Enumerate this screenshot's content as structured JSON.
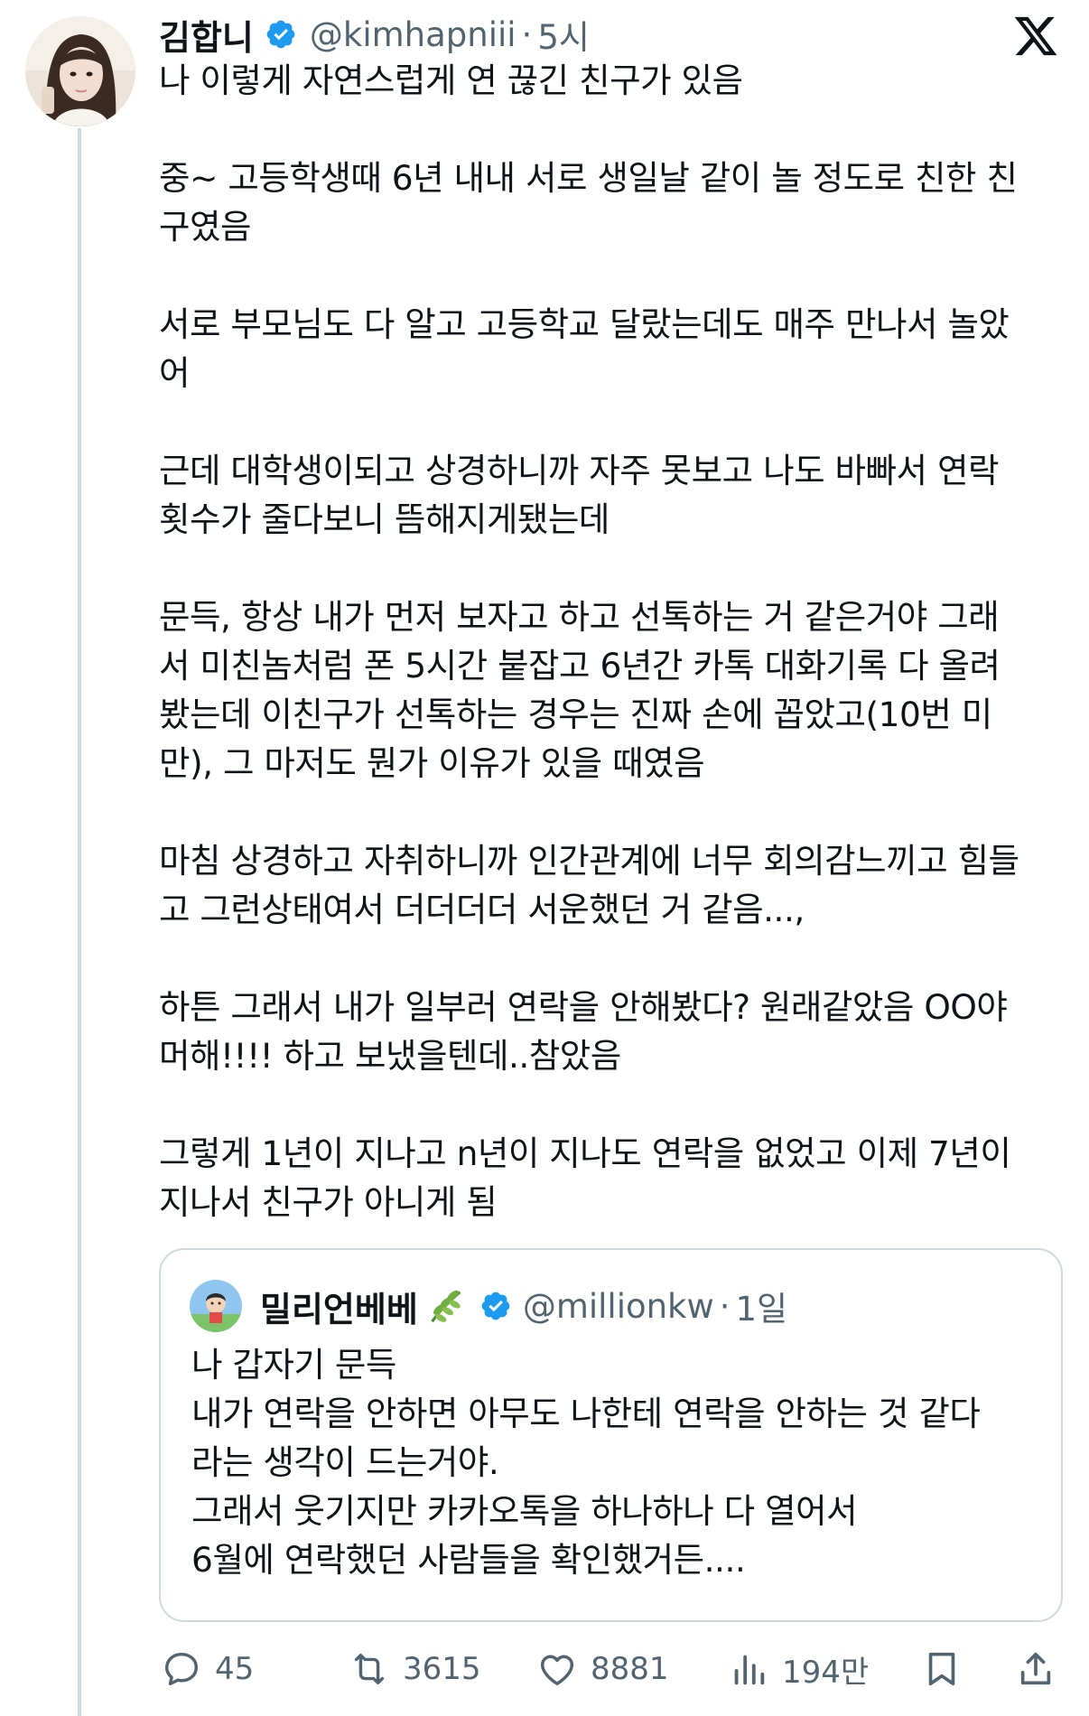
{
  "author": {
    "display_name": "김합니",
    "handle": "@kimhapniii",
    "time": "5시"
  },
  "tweet": {
    "paragraphs": [
      "나 이렇게 자연스럽게 연 끊긴 친구가 있음",
      "중~ 고등학생때 6년 내내 서로 생일날 같이 놀 정도로 친한 친\n구였음",
      "서로 부모님도 다 알고 고등학교 달랐는데도 매주 만나서 놀았\n어",
      "근데 대학생이되고 상경하니까 자주 못보고 나도 바빠서 연락\n횟수가 줄다보니 뜸해지게됐는데",
      "문득, 항상 내가 먼저 보자고 하고 선톡하는 거 같은거야 그래\n서 미친놈처럼 폰 5시간 붙잡고 6년간 카톡 대화기록 다 올려\n봤는데 이친구가 선톡하는 경우는 진짜 손에 꼽았고(10번 미\n만), 그 마저도 뭔가 이유가 있을 때였음",
      "마침 상경하고 자취하니까 인간관계에 너무 회의감느끼고 힘들\n고 그런상태여서 더더더더 서운했던 거 같음...,",
      "하튼 그래서 내가 일부러 연락을 안해봤다? 원래같았음 OO야\n머해!!!! 하고 보냈을텐데..참았음",
      "그렇게 1년이 지나고 n년이 지나도 연락을 없었고 이제 7년이\n지나서 친구가 아니게 됨"
    ]
  },
  "quote": {
    "display_name": "밀리언베베",
    "handle": "@millionkw",
    "time": "1일",
    "text": "나 갑자기 문득\n내가 연락을 안하면 아무도 나한테 연락을 안하는 것 같다\n라는 생각이 드는거야.\n그래서 웃기지만 카카오톡을 하나하나 다 열어서\n6월에 연락했던 사람들을 확인했거든...."
  },
  "actions": {
    "replies": "45",
    "reposts": "3615",
    "likes": "8881",
    "views": "194만"
  },
  "icons": [
    "x-logo-icon",
    "verified-badge-icon",
    "leaf-icon",
    "reply-icon",
    "repost-icon",
    "like-icon",
    "views-icon",
    "bookmark-icon",
    "share-icon"
  ],
  "colors": {
    "text": "#0f1419",
    "secondary": "#536471",
    "verified": "#1d9bf0",
    "border": "#cfd9de"
  }
}
